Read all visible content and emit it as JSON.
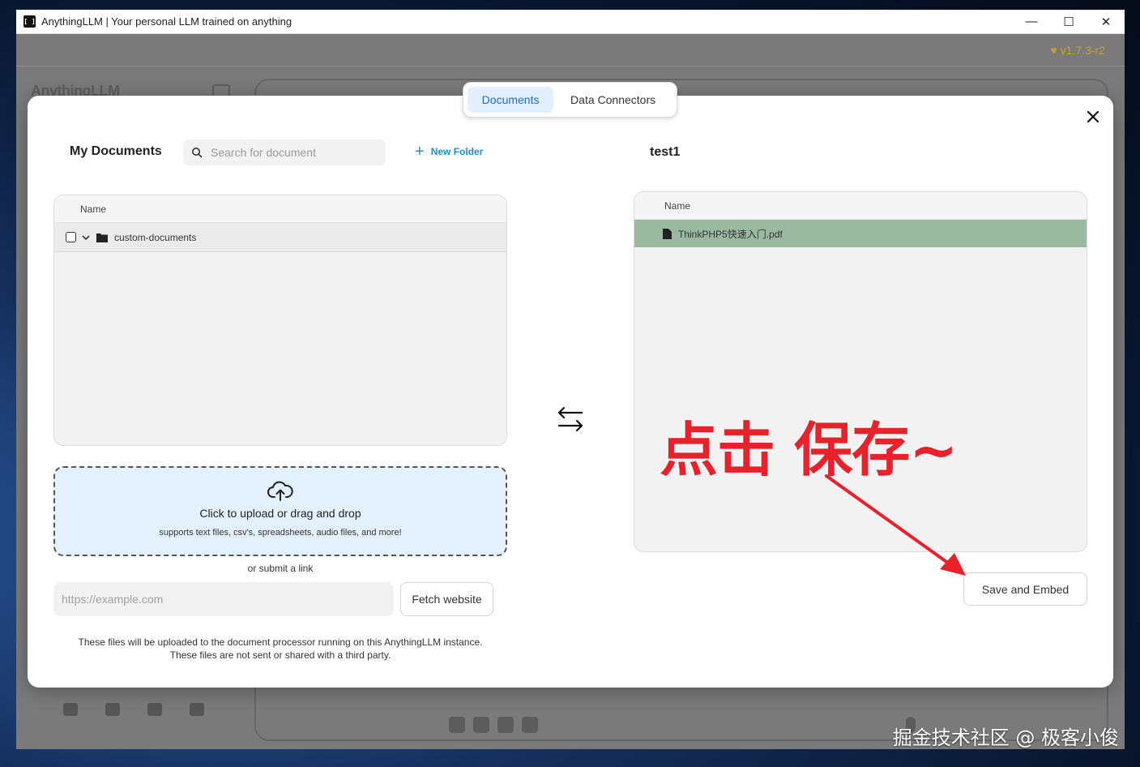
{
  "window": {
    "title": "AnythingLLM | Your personal LLM trained on anything",
    "app_icon_text": "[ ]",
    "minimize": "—",
    "maximize": "☐",
    "close": "✕"
  },
  "app": {
    "version": "v1.7.3-r2",
    "logo": "AnythingLLM"
  },
  "modal": {
    "tabs": [
      {
        "label": "Documents",
        "active": true
      },
      {
        "label": "Data Connectors",
        "active": false
      }
    ],
    "left": {
      "title": "My Documents",
      "search_placeholder": "Search for document",
      "new_folder_label": "New Folder",
      "table_header": "Name",
      "folders": [
        {
          "name": "custom-documents",
          "checked": false,
          "expanded": true
        }
      ],
      "upload": {
        "title": "Click to upload or drag and drop",
        "subtitle": "supports text files, csv's, spreadsheets, audio files, and more!"
      },
      "or_link_text": "or submit a link",
      "url_placeholder": "https://example.com",
      "fetch_label": "Fetch website",
      "notice_line1": "These files will be uploaded to the document processor running on this AnythingLLM instance.",
      "notice_line2": "These files are not sent or shared with a third party."
    },
    "right": {
      "workspace_title": "test1",
      "table_header": "Name",
      "files": [
        {
          "name": "ThinkPHP5快速入门.pdf",
          "selected": true
        }
      ],
      "save_label": "Save and Embed"
    }
  },
  "annotation": {
    "text": "点击 保存~",
    "color": "#e8212a"
  },
  "watermark": "掘金技术社区 @ 极客小俊",
  "colors": {
    "accent": "#1a6fc9",
    "version": "#c9a227",
    "selected_row": "#9ab9a0",
    "upload_bg": "#e2f1fd"
  }
}
